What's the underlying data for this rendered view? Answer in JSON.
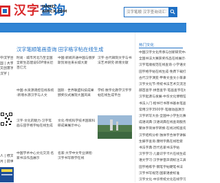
{
  "header": {
    "logo_text": "汉字查询",
    "logo_domain_line1": "HANZI",
    "logo_domain_line2": "AIMCX.COM",
    "search_placeholder": "汉字笔顺 汉字查询词汇字"
  },
  "main": {
    "title": "汉字笔顺笔画查询 田字格字帖在线生成",
    "left_col": [
      "中汉字丝绸之路·",
      "国 | 大学科",
      "文创意字",
      "汉字 |",
      "",
      "",
      "",
      "",
      "",
      "",
      "",
      "",
      "",
      "",
      "人 | 修文化",
      "月 | 前世界"
    ],
    "cards": [
      {
        "text": "时尚 · 城市河北乃至全国全新生态建设GDP增长近百亿元"
      },
      {
        "text": "中国·新闻开通中国与俄罗斯贸易往来长城大厦"
      },
      {
        "text": "中国·水资源调控在线系统·新增水源汉字与人文"
      },
      {
        "text": "国际 · 世界联盟科技成果颁奖仪式展现大国风采"
      },
      {
        "text": "汉字·文化的魅力·汉字笔画与田字格字帖在线生成"
      },
      {
        "text": "文化·传统科学技术国家科研成果展示中心"
      },
      {
        "text": "中国学术中心文化交流·名家书法作品展示"
      },
      {
        "text": "名家·大学中文专业课程·汉字书写教学在线"
      },
      {
        "text": "汉字·古代碑刻文字与书法艺术研究·新增文献"
      },
      {
        "text": "学校·数字化教学汉字字帖在线生成平台"
      }
    ]
  },
  "sidebar": {
    "heading": "热门文化",
    "items": [
      "中国汉字文化传承与创新研究中心发布",
      "全国书法大赛获奖作品在线展示·北京",
      "汉字笔顺规范在线查询·小学语文教材",
      "田字格字帖在线生成·免费下载打印",
      "古代汉字演变·甲骨文金文小篆隶书",
      "汉字文化节·传统书法艺术交流活动",
      "部首查字·拼音查字·笔画查字在线工具",
      "汉字起源与发展·中华文化博物馆",
      "书法入门·楷书行书草书基本笔画",
      "常用汉字3500字·笔顺动画演示",
      "汉字听写大会·全国中小学生比赛",
      "成语词典·汉语词典在线查询服务",
      "繁体字简体字转换·在线对照查询",
      "汉字结构分析·独体字合体字讲解",
      "生僻字查询·康熙字典在线检索",
      "书法字典·历代名家书法字帖",
      "汉字学习·儿童识字卡片在线生成",
      "语文学习·汉字拼音声调标注工具",
      "田字格练字·钢笔字帖硬笔书法",
      "汉字书写规范·国家语委标准",
      "汉字文化·中华传统文化在线学习"
    ]
  }
}
